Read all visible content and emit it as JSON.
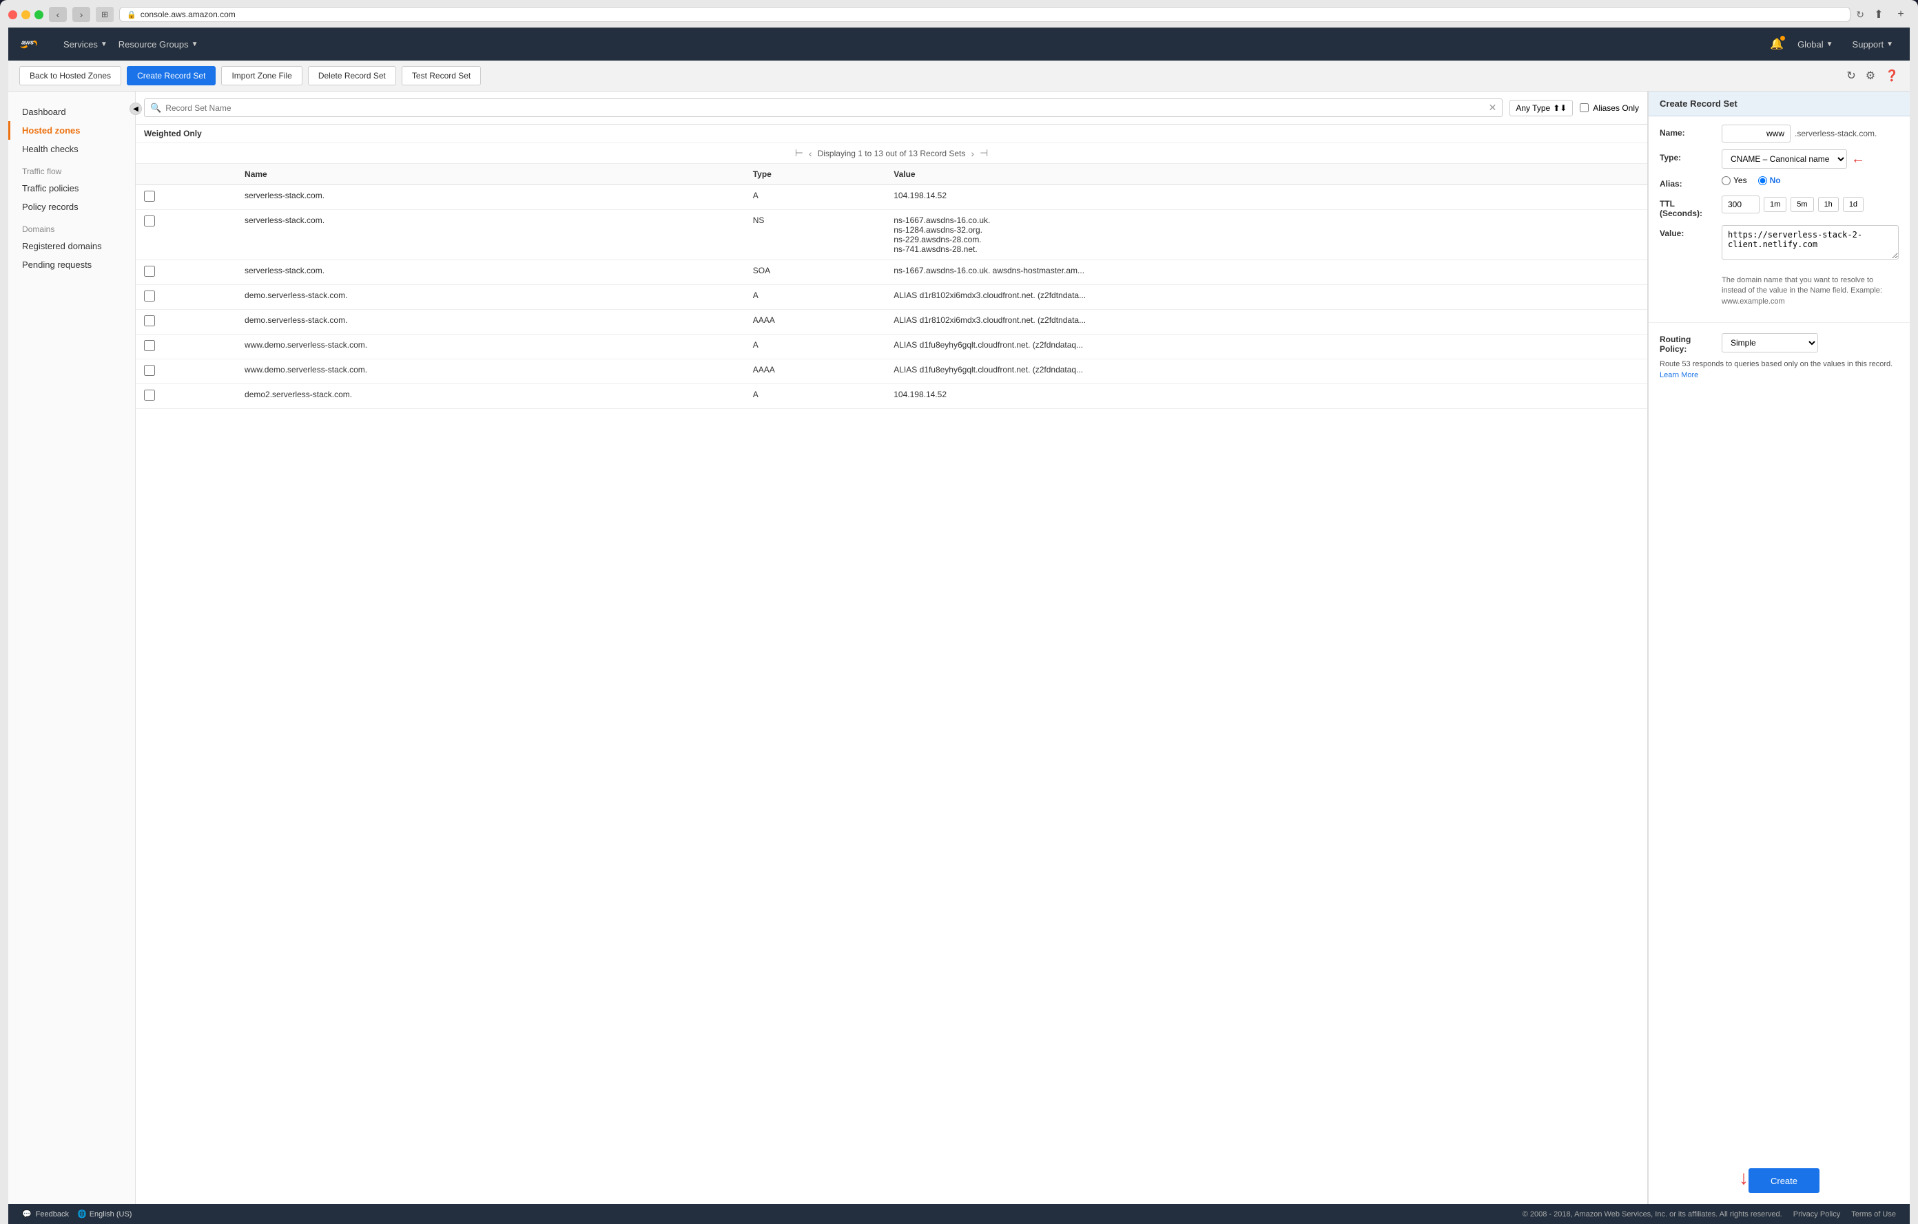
{
  "browser": {
    "url": "console.aws.amazon.com"
  },
  "topnav": {
    "services_label": "Services",
    "resource_groups_label": "Resource Groups",
    "global_label": "Global",
    "support_label": "Support"
  },
  "action_bar": {
    "back_btn": "Back to Hosted Zones",
    "create_btn": "Create Record Set",
    "import_btn": "Import Zone File",
    "delete_btn": "Delete Record Set",
    "test_btn": "Test Record Set"
  },
  "filter": {
    "placeholder": "Record Set Name",
    "type_label": "Any Type",
    "alias_label": "Aliases Only"
  },
  "record_list": {
    "weighted_label": "Weighted Only",
    "pagination": "Displaying 1 to 13 out of 13 Record Sets",
    "columns": [
      "Name",
      "Type",
      "Value"
    ],
    "rows": [
      {
        "name": "serverless-stack.com.",
        "type": "A",
        "value": "104.198.14.52"
      },
      {
        "name": "serverless-stack.com.",
        "type": "NS",
        "value": "ns-1667.awsdns-16.co.uk.\nns-1284.awsdns-32.org.\nns-229.awsdns-28.com.\nns-741.awsdns-28.net."
      },
      {
        "name": "serverless-stack.com.",
        "type": "SOA",
        "value": "ns-1667.awsdns-16.co.uk. awsdns-hostmaster.am..."
      },
      {
        "name": "demo.serverless-stack.com.",
        "type": "A",
        "value": "ALIAS d1r8102xi6mdx3.cloudfront.net. (z2fdtndata..."
      },
      {
        "name": "demo.serverless-stack.com.",
        "type": "AAAA",
        "value": "ALIAS d1r8102xi6mdx3.cloudfront.net. (z2fdtndata..."
      },
      {
        "name": "www.demo.serverless-stack.com.",
        "type": "A",
        "value": "ALIAS d1fu8eyhy6gqlt.cloudfront.net. (z2fdndataq..."
      },
      {
        "name": "www.demo.serverless-stack.com.",
        "type": "AAAA",
        "value": "ALIAS d1fu8eyhy6gqlt.cloudfront.net. (z2fdndataq..."
      },
      {
        "name": "demo2.serverless-stack.com.",
        "type": "A",
        "value": "104.198.14.52"
      }
    ]
  },
  "create_panel": {
    "title": "Create Record Set",
    "name_label": "Name:",
    "name_value": "www",
    "name_suffix": ".serverless-stack.com.",
    "type_label": "Type:",
    "type_value": "CNAME – Canonical name",
    "alias_label": "Alias:",
    "alias_yes": "Yes",
    "alias_no": "No",
    "ttl_label": "TTL (Seconds):",
    "ttl_value": "300",
    "ttl_1m": "1m",
    "ttl_5m": "5m",
    "ttl_1h": "1h",
    "ttl_1d": "1d",
    "value_label": "Value:",
    "value_content": "https://serverless-stack-2-client.netlify.com",
    "value_hint": "The domain name that you want to resolve to instead of the value in the Name field.\nExample:\nwww.example.com",
    "routing_label": "Routing Policy:",
    "routing_value": "Simple",
    "routing_hint": "Route 53 responds to queries based only on the values in this record.",
    "routing_learn_more": "Learn More",
    "create_btn": "Create"
  },
  "sidebar": {
    "dashboard": "Dashboard",
    "hosted_zones": "Hosted zones",
    "health_checks": "Health checks",
    "traffic_flow_label": "Traffic flow",
    "traffic_policies": "Traffic policies",
    "policy_records": "Policy records",
    "domains_label": "Domains",
    "registered_domains": "Registered domains",
    "pending_requests": "Pending requests"
  },
  "footer": {
    "feedback": "Feedback",
    "language": "English (US)",
    "copyright": "© 2008 - 2018, Amazon Web Services, Inc. or its affiliates. All rights reserved.",
    "privacy": "Privacy Policy",
    "terms": "Terms of Use"
  }
}
